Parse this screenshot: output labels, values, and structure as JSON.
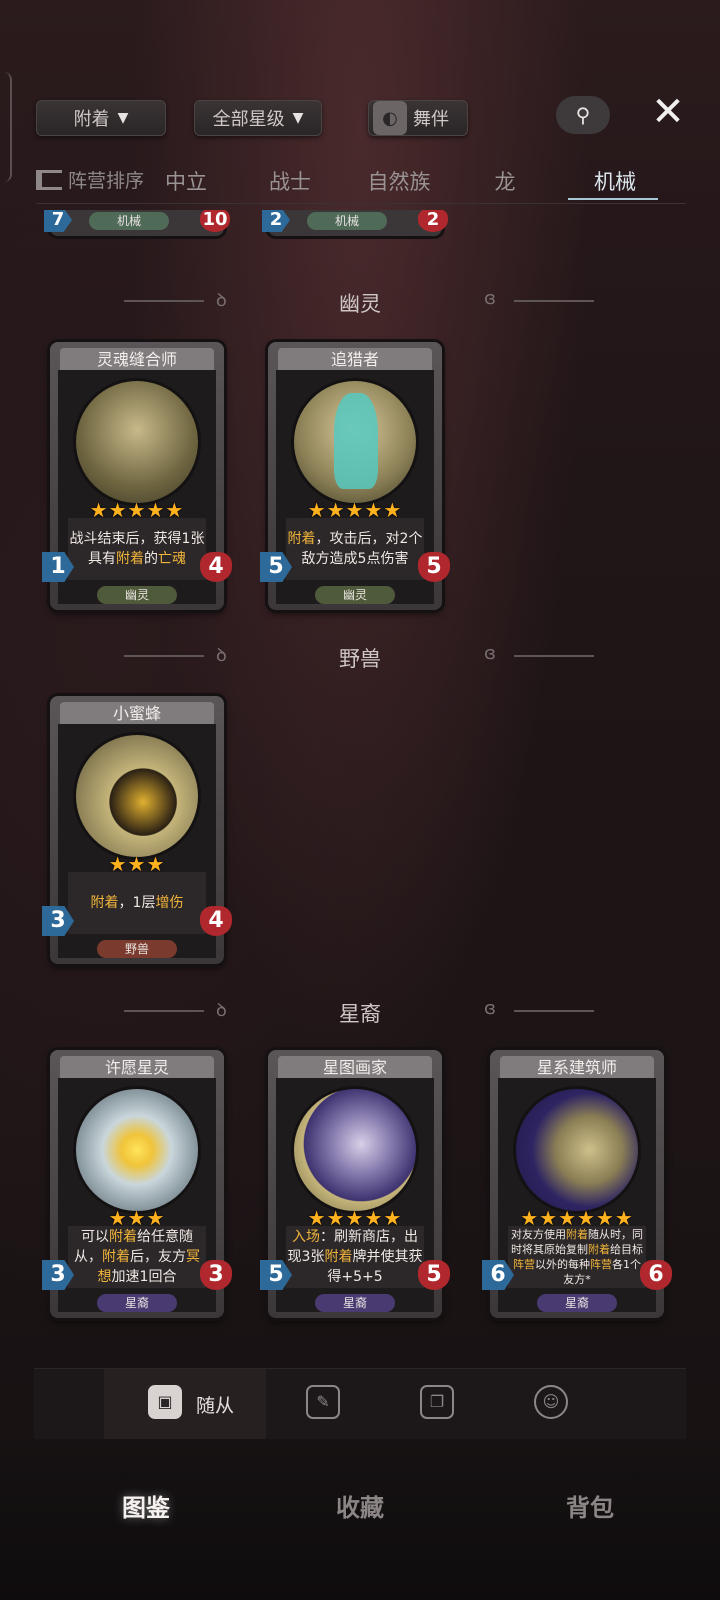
{
  "top_bar": {
    "attach_filter": "附着",
    "star_filter": "全部星级",
    "dance_label": "舞伴",
    "search_icon": "search-icon",
    "close_icon": "close-icon"
  },
  "tribe_tabs": {
    "sort_label": "阵营排序",
    "tabs": [
      "中立",
      "战士",
      "自然族",
      "龙",
      "机械"
    ],
    "active": "机械"
  },
  "stub_cards": [
    {
      "attack": "7",
      "tribe": "机械",
      "health": "10"
    },
    {
      "attack": "2",
      "tribe": "机械",
      "health": "2"
    }
  ],
  "sections": [
    {
      "title": "幽灵",
      "cards": [
        {
          "name": "灵魂缝合师",
          "stars": "★★★★★",
          "desc_parts": [
            "战斗结束后，获得1张具有",
            "附着",
            "的",
            "亡魂"
          ],
          "attack": "1",
          "health": "4",
          "tribe": "幽灵"
        },
        {
          "name": "追猎者",
          "stars": "★★★★★",
          "desc_parts": [
            "附着",
            "，攻击后，对2个敌方造成5点伤害"
          ],
          "attack": "5",
          "health": "5",
          "tribe": "幽灵"
        }
      ]
    },
    {
      "title": "野兽",
      "cards": [
        {
          "name": "小蜜蜂",
          "stars": "★★★",
          "desc_parts": [
            "附着",
            "，1层",
            "增伤"
          ],
          "attack": "3",
          "health": "4",
          "tribe": "野兽"
        }
      ]
    },
    {
      "title": "星裔",
      "cards": [
        {
          "name": "许愿星灵",
          "stars": "★★★",
          "desc_parts": [
            "可以",
            "附着",
            "给任意随从，",
            "附着",
            "后，友方",
            "冥想",
            "加速1回合"
          ],
          "attack": "3",
          "health": "3",
          "tribe": "星裔"
        },
        {
          "name": "星图画家",
          "stars": "★★★★★",
          "desc_parts": [
            "入场",
            "：刷新商店，出现3张",
            "附着",
            "牌并使其获得+5+5"
          ],
          "attack": "5",
          "health": "5",
          "tribe": "星裔"
        },
        {
          "name": "星系建筑师",
          "stars": "★★★★★★",
          "desc_parts": [
            "对友方使用",
            "附着",
            "随从时，同时将其原始复制",
            "附着",
            "给目标",
            "阵营",
            "以外的每种",
            "阵营",
            "各1个友方*"
          ],
          "attack": "6",
          "health": "6",
          "tribe": "星裔"
        }
      ]
    }
  ],
  "type_tabs": {
    "active_label": "随从",
    "icons": [
      "minion-icon",
      "spell-icon",
      "equipment-icon",
      "hero-icon"
    ]
  },
  "bottom_nav": [
    "图鉴",
    "收藏",
    "背包"
  ],
  "colors": {
    "highlight": "#f0b43a",
    "attack": "#2d6a9a",
    "health": "#b0282d",
    "star": "#ffb21e",
    "ghost_tribe": "#4f5a3a",
    "beast_tribe": "#7a3a2e",
    "star_tribe": "#4a3a72",
    "mech_tribe": "#4f6b57"
  }
}
